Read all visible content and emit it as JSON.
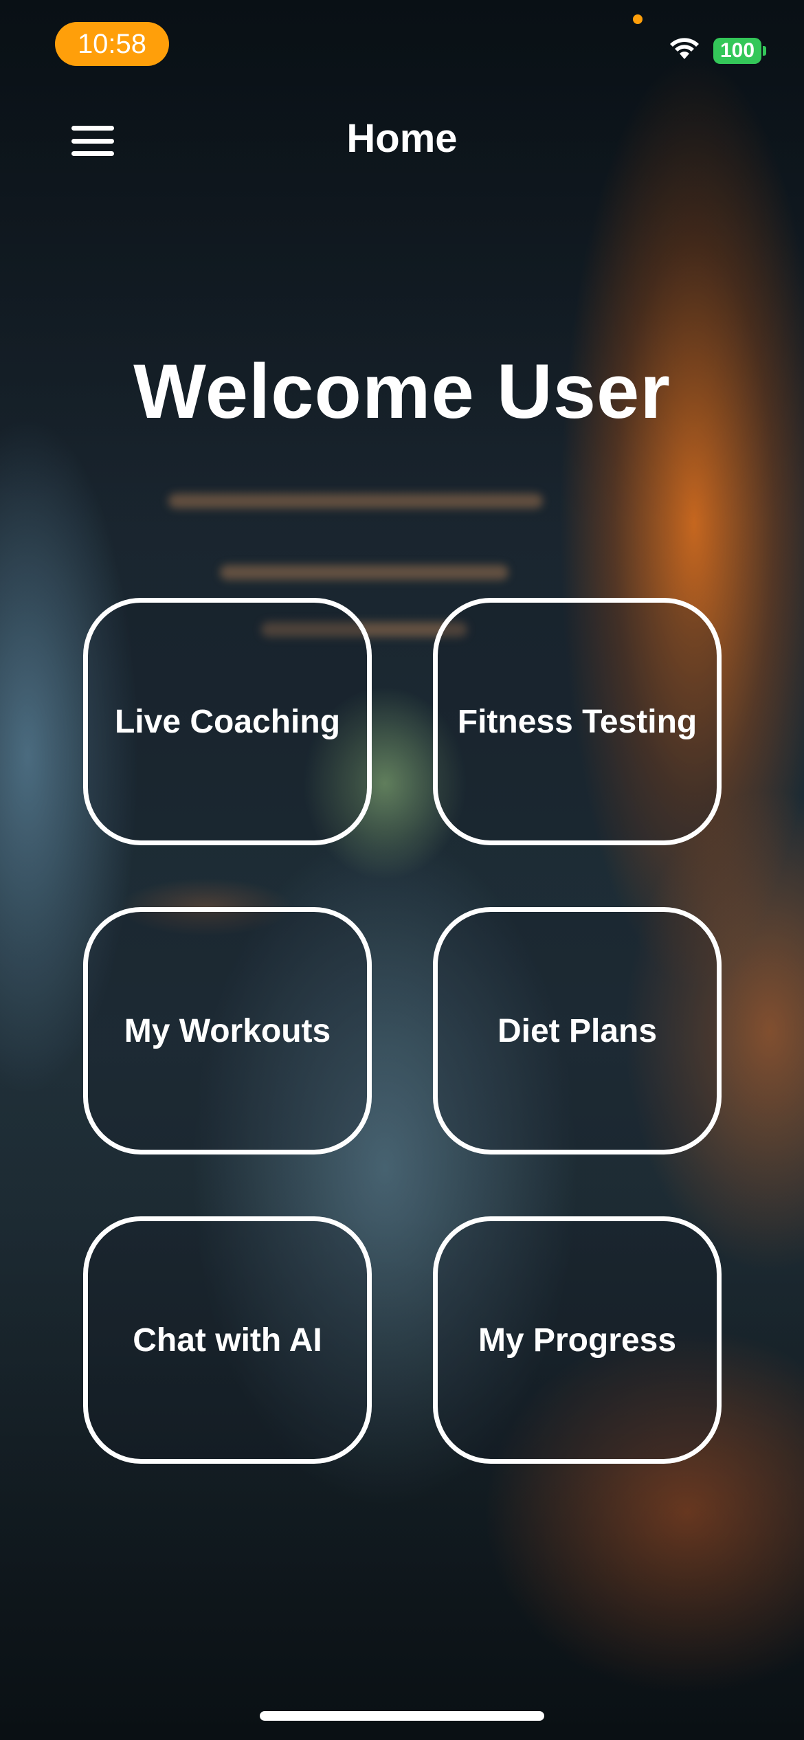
{
  "status_bar": {
    "time": "10:58",
    "battery": "100",
    "wifi_icon": "wifi-icon",
    "accent_color": "#ff9f0a",
    "battery_color": "#34c759"
  },
  "nav": {
    "title": "Home",
    "menu_icon": "hamburger-menu-icon"
  },
  "welcome": "Welcome User",
  "tiles": [
    {
      "label": "Live Coaching"
    },
    {
      "label": "Fitness Testing"
    },
    {
      "label": "My Workouts"
    },
    {
      "label": "Diet Plans"
    },
    {
      "label": "Chat with AI"
    },
    {
      "label": "My Progress"
    }
  ]
}
